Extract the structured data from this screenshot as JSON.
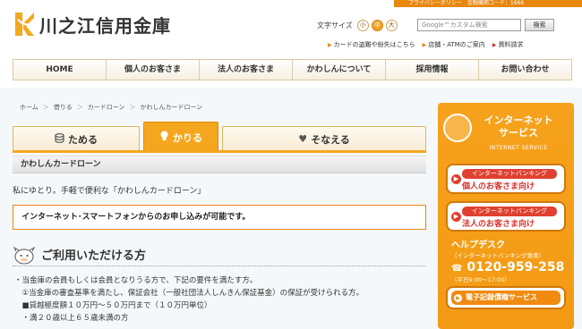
{
  "header": {
    "logo_text": "川之江信用金庫",
    "privacy_bar": "プライバシーポリシー　金融機関コード：1666",
    "text_size_label": "文字サイズ",
    "text_sizes": [
      "小",
      "中",
      "大"
    ],
    "search_placeholder": "Google™カスタム検索",
    "search_button": "検索",
    "sublinks": [
      "カードの盗難や紛失はこちら",
      "店舗・ATMのご案内",
      "資料請求"
    ]
  },
  "nav": [
    "HOME",
    "個人のお客さま",
    "法人のお客さま",
    "かわしんについて",
    "採用情報",
    "お問い合わせ"
  ],
  "breadcrumb": [
    "ホーム",
    "借りる",
    "カードローン",
    "かわしんカードローン"
  ],
  "tabs": [
    {
      "label": "ためる",
      "icon": "coins-icon",
      "glyph": "☰"
    },
    {
      "label": "かりる",
      "icon": "lightbulb-icon",
      "glyph": "💡"
    },
    {
      "label": "そなえる",
      "icon": "heart-icon",
      "glyph": "♥"
    }
  ],
  "section_title": "かわしんカードローン",
  "intro": "私にゆとり。手軽で便利な「かわしんカードローン」",
  "notice": "インターネット･スマートフォンからのお申し込みが可能です。",
  "heading": "ご利用いただける方",
  "requirements": [
    "・当金庫の会員もしくは会員となりうる方で、下記の要件を満たす方。",
    "　①当金庫の審査基準を満たし、保証会社（一般社団法人しんきん保証基金）の保証が受けられる方。",
    "　■貸越極度額１０万円～５０万円まで（１０万円単位）",
    "　・満２０歳以上６５歳未満の方"
  ],
  "sidebar": {
    "title_line1": "インターネット",
    "title_line2": "サービス",
    "subtitle": "INTERNET SERVICE",
    "btn1_top": "インターネットバンキング",
    "btn1_bottom": "個人のお客さま向け",
    "btn2_top": "インターネットバンキング",
    "btn2_bottom": "法人のお客さま向け",
    "helpdesk_title": "ヘルプデスク",
    "helpdesk_sub": "（インターネットバンキング専用）",
    "helpdesk_phone": "0120-959-258",
    "helpdesk_hours": "（平日9:00～17:00）",
    "green_button": "電子記録債権サービス"
  },
  "colors": {
    "accent": "#f4a71e",
    "accent_dark": "#e8870d",
    "red": "#d9302a"
  }
}
